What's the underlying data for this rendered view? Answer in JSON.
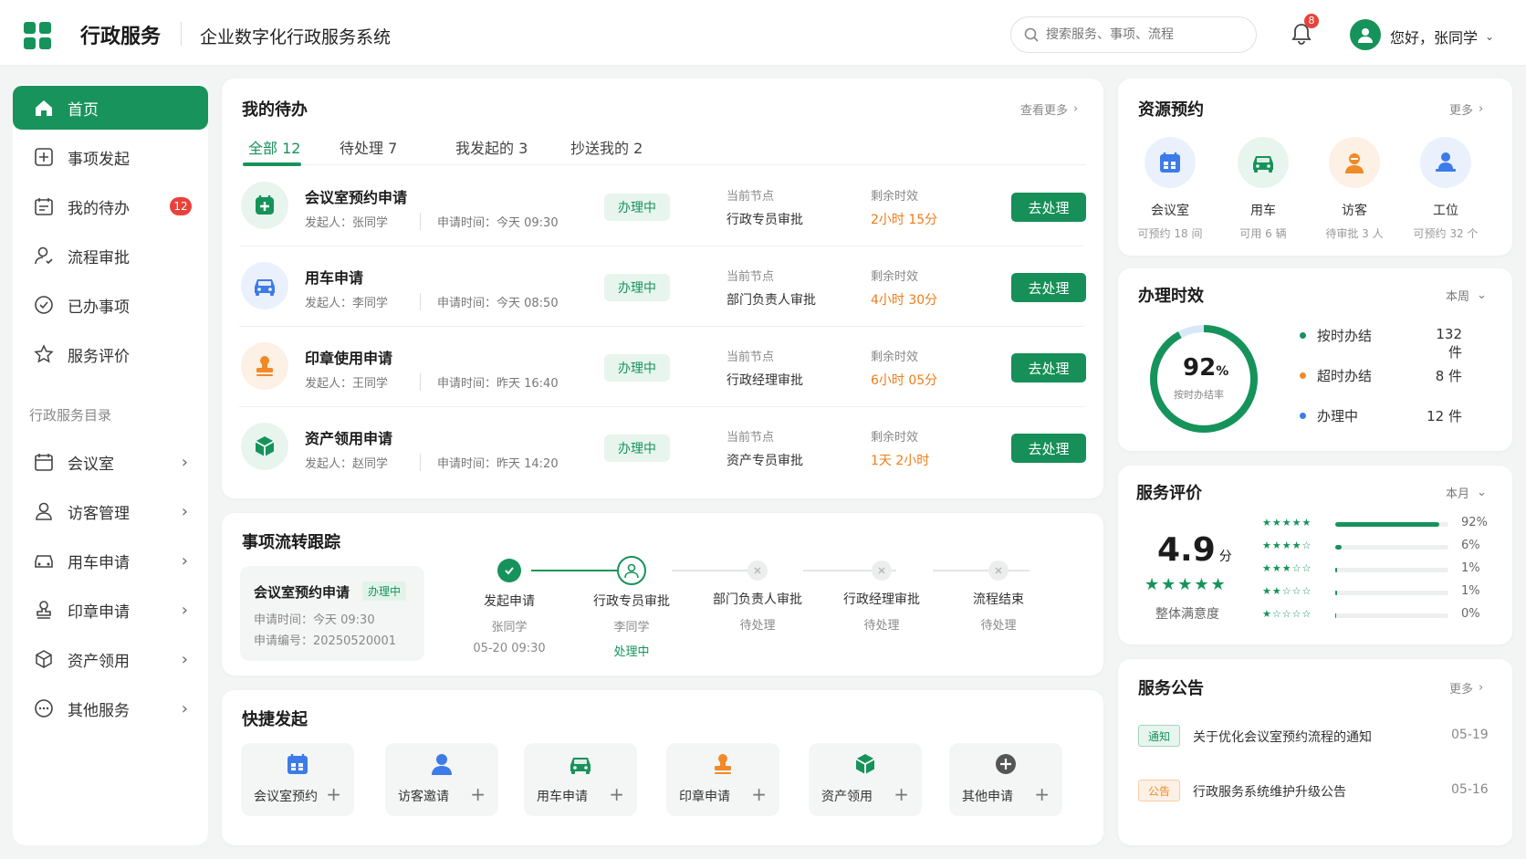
{
  "header": {
    "brand": "行政服务",
    "subtitle": "企业数字化行政服务系统",
    "search_placeholder": "搜索服务、事项、流程",
    "notification_count": "8",
    "greeting": "您好，张同学"
  },
  "sidebar": {
    "items": [
      {
        "label": "首页",
        "icon": "home-icon"
      },
      {
        "label": "事项发起",
        "icon": "plus-square-icon"
      },
      {
        "label": "我的待办",
        "icon": "calendar-icon",
        "badge": "12"
      },
      {
        "label": "流程审批",
        "icon": "user-icon"
      },
      {
        "label": "已办事项",
        "icon": "check-circle-icon"
      },
      {
        "label": "服务评价",
        "icon": "star-icon"
      }
    ],
    "catalog_title": "行政服务目录",
    "catalog": [
      {
        "label": "会议室",
        "icon": "calendar-icon"
      },
      {
        "label": "访客管理",
        "icon": "user-icon"
      },
      {
        "label": "用车申请",
        "icon": "car-icon"
      },
      {
        "label": "印章申请",
        "icon": "stamp-icon"
      },
      {
        "label": "资产领用",
        "icon": "box-icon"
      },
      {
        "label": "其他服务",
        "icon": "more-circle-icon"
      }
    ]
  },
  "todo": {
    "title": "我的待办",
    "more": "查看更多",
    "tabs": [
      {
        "label": "全部",
        "count": "12"
      },
      {
        "label": "待处理",
        "count": "7"
      },
      {
        "label": "我发起的",
        "count": "3"
      },
      {
        "label": "抄送我的",
        "count": "2"
      }
    ],
    "node_label": "当前节点",
    "remaining_label": "剩余时效",
    "action_label": "去处理",
    "rows": [
      {
        "title": "会议室预约申请",
        "initiator": "发起人：张同学",
        "time": "申请时间：今天 09:30",
        "status": "办理中",
        "node": "行政专员审批",
        "remaining": "2小时 15分",
        "icon": "meeting-room-icon",
        "color": "#16935a"
      },
      {
        "title": "用车申请",
        "initiator": "发起人：李同学",
        "time": "申请时间：今天 08:50",
        "status": "办理中",
        "node": "部门负责人审批",
        "remaining": "4小时 30分",
        "icon": "car-icon",
        "color": "#3d7be8"
      },
      {
        "title": "印章使用申请",
        "initiator": "发起人：王同学",
        "time": "申请时间：昨天 16:40",
        "status": "办理中",
        "node": "行政经理审批",
        "remaining": "6小时 05分",
        "icon": "stamp-icon",
        "color": "#f08a28"
      },
      {
        "title": "资产领用申请",
        "initiator": "发起人：赵同学",
        "time": "申请时间：昨天 14:20",
        "status": "办理中",
        "node": "资产专员审批",
        "remaining": "1天 2小时",
        "icon": "box-icon",
        "color": "#16935a"
      }
    ]
  },
  "flow": {
    "title": "事项流转跟踪",
    "item_title": "会议室预约申请",
    "item_status": "办理中",
    "item_time": "申请时间：今天 09:30",
    "item_no": "申请编号：20250520001",
    "steps": [
      {
        "name": "发起申请",
        "person": "张同学",
        "extra": "05-20 09:30",
        "state": "done"
      },
      {
        "name": "行政专员审批",
        "person": "李同学",
        "extra": "处理中",
        "state": "current"
      },
      {
        "name": "部门负责人审批",
        "person": "待处理",
        "extra": "",
        "state": "pending"
      },
      {
        "name": "行政经理审批",
        "person": "待处理",
        "extra": "",
        "state": "pending"
      },
      {
        "name": "流程结束",
        "person": "待处理",
        "extra": "",
        "state": "pending"
      }
    ]
  },
  "quick": {
    "title": "快捷发起",
    "items": [
      {
        "label": "会议室预约",
        "icon": "calendar-icon",
        "color": "#3d7be8"
      },
      {
        "label": "访客邀请",
        "icon": "user-icon",
        "color": "#3d7be8"
      },
      {
        "label": "用车申请",
        "icon": "car-icon",
        "color": "#16935a"
      },
      {
        "label": "印章申请",
        "icon": "stamp-icon",
        "color": "#f08a28"
      },
      {
        "label": "资产领用",
        "icon": "box-icon",
        "color": "#16935a"
      },
      {
        "label": "其他申请",
        "icon": "more-circle-icon",
        "color": "#555555"
      }
    ]
  },
  "resources": {
    "title": "资源预约",
    "more": "更多",
    "items": [
      {
        "name": "会议室",
        "sub": "可预约 18 间",
        "icon": "calendar-icon",
        "color": "#3d7be8",
        "bg": "#eaf1fd"
      },
      {
        "name": "用车",
        "sub": "可用 6 辆",
        "icon": "car-icon",
        "color": "#16935a",
        "bg": "#e8f5ee"
      },
      {
        "name": "访客",
        "sub": "待审批 3 人",
        "icon": "visitor-icon",
        "color": "#f08a28",
        "bg": "#fdf0e4"
      },
      {
        "name": "工位",
        "sub": "可预约 32 个",
        "icon": "desk-icon",
        "color": "#3d7be8",
        "bg": "#eaf1fd"
      }
    ]
  },
  "performance": {
    "title": "办理时效",
    "period": "本周",
    "rate_value": "92",
    "rate_unit": "%",
    "rate_label": "按时办结率",
    "rate": 0.92,
    "legend": [
      {
        "label": "按时办结",
        "value": "132 件",
        "color": "#16935a"
      },
      {
        "label": "超时办结",
        "value": "8 件",
        "color": "#f08a28"
      },
      {
        "label": "办理中",
        "value": "12 件",
        "color": "#3d7be8"
      }
    ]
  },
  "evaluation": {
    "title": "服务评价",
    "period": "本月",
    "score": "4.9",
    "unit": "分",
    "stars": "★★★★★",
    "label": "整体满意度",
    "dist": [
      {
        "stars": "★★★★★",
        "pct": "92%",
        "value": 0.92
      },
      {
        "stars": "★★★★☆",
        "pct": "6%",
        "value": 0.06
      },
      {
        "stars": "★★★☆☆",
        "pct": "1%",
        "value": 0.01
      },
      {
        "stars": "★★☆☆☆",
        "pct": "1%",
        "value": 0.01
      },
      {
        "stars": "★☆☆☆☆",
        "pct": "0%",
        "value": 0.0
      }
    ]
  },
  "notices": {
    "title": "服务公告",
    "more": "更多",
    "items": [
      {
        "tag": "通知",
        "text": "关于优化会议室预约流程的通知",
        "date": "05-19",
        "color": "#16935a",
        "bg": "#e8f5ee"
      },
      {
        "tag": "公告",
        "text": "行政服务系统维护升级公告",
        "date": "05-16",
        "color": "#f08a28",
        "bg": "#fdf0e4"
      }
    ]
  }
}
